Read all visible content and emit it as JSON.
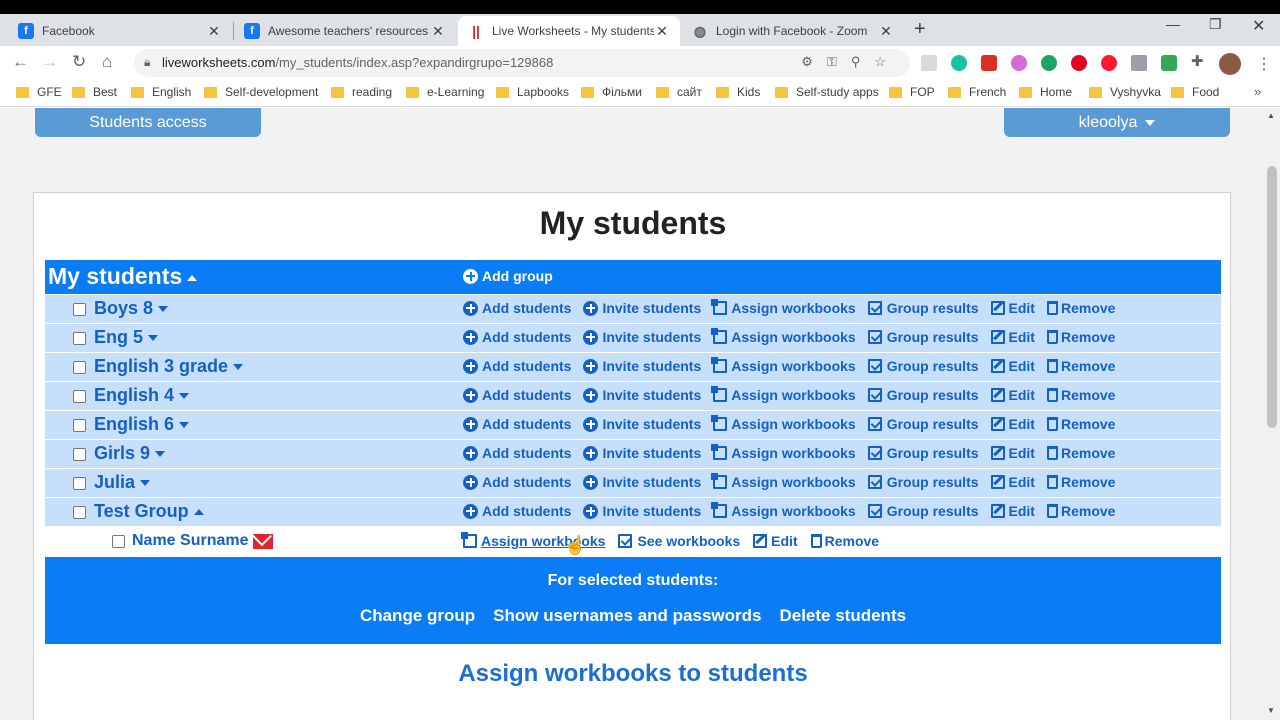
{
  "browser": {
    "tabs": [
      {
        "label": "Facebook",
        "icon": "facebook-icon"
      },
      {
        "label": "Awesome teachers' resources",
        "icon": "facebook-icon"
      },
      {
        "label": "Live Worksheets - My students",
        "icon": "liveworksheets-icon"
      },
      {
        "label": "Login with Facebook - Zoom",
        "icon": "globe-icon"
      }
    ],
    "url_domain": "liveworksheets.com",
    "url_path": "/my_students/index.asp?expandirgrupo=129868",
    "bookmarks": [
      "GFE",
      "Best",
      "English",
      "Self-development",
      "reading",
      "e-Learning",
      "Lapbooks",
      "Фільми",
      "сайт",
      "Kids",
      "Self-study apps",
      "FOP",
      "French",
      "Home",
      "Vyshyvka",
      "Food"
    ],
    "bookmarks_more": "»"
  },
  "top": {
    "students_access": "Students access",
    "user_menu": "kleoolya"
  },
  "main": {
    "title": "My students",
    "header_label": "My students",
    "add_group": "Add group",
    "actions": {
      "add_students": "Add students",
      "invite_students": "Invite students",
      "assign_workbooks": "Assign workbooks",
      "group_results": "Group results",
      "edit": "Edit",
      "remove": "Remove",
      "see_workbooks": "See workbooks"
    },
    "groups": [
      "Boys 8",
      "Eng 5",
      "English 3 grade",
      "English 4",
      "English 6",
      "Girls 9",
      "Julia",
      "Test Group"
    ],
    "student": "Name Surname",
    "selected": {
      "title": "For selected students:",
      "change_group": "Change group",
      "show_usernames": "Show usernames and passwords",
      "delete_students": "Delete students"
    },
    "assign_title": "Assign workbooks to students"
  },
  "colors": {
    "primary_blue": "#0a7cf5",
    "row_blue": "#c6e0fb",
    "link_blue": "#1560c6",
    "button_blue": "#5b9bd5"
  }
}
